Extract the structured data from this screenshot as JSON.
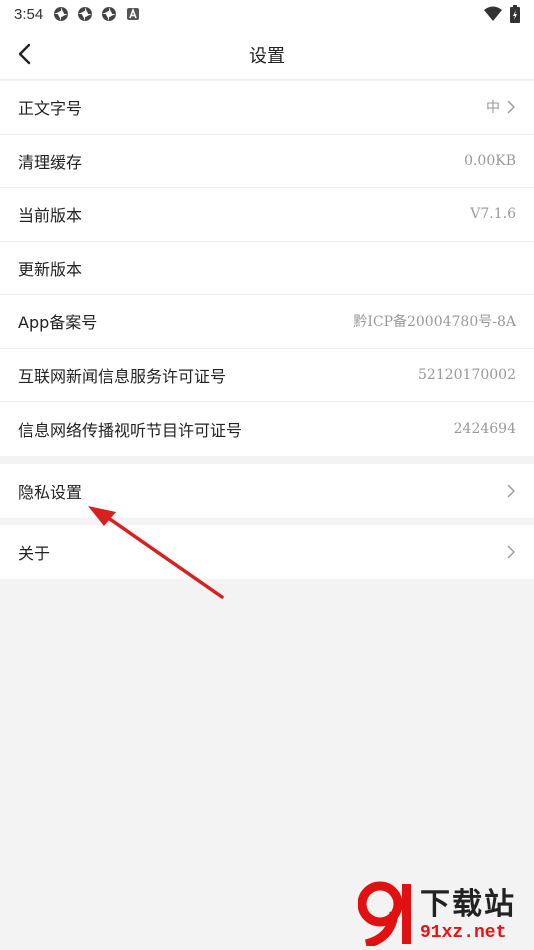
{
  "status_bar": {
    "time": "3:54",
    "icons": [
      "pinwheel-icon",
      "pinwheel-icon",
      "pinwheel-icon",
      "notification-a-icon"
    ],
    "right_icons": [
      "wifi-icon",
      "battery-charging-icon"
    ]
  },
  "header": {
    "title": "设置",
    "back_icon": "back-arrow-icon"
  },
  "settings": [
    {
      "label": "正文字号",
      "value": "中",
      "chevron": true
    },
    {
      "label": "清理缓存",
      "value": "0.00KB",
      "chevron": false
    },
    {
      "label": "当前版本",
      "value": "V7.1.6",
      "chevron": false
    },
    {
      "label": "更新版本",
      "value": "",
      "chevron": false
    },
    {
      "label": "App备案号",
      "value": "黔ICP备20004780号-8A",
      "chevron": false
    },
    {
      "label": "互联网新闻信息服务许可证号",
      "value": "52120170002",
      "chevron": false
    },
    {
      "label": "信息网络传播视听节目许可证号",
      "value": "2424694",
      "chevron": false
    }
  ],
  "privacy": {
    "label": "隐私设置"
  },
  "about": {
    "label": "关于"
  },
  "watermark": {
    "title": "下载站",
    "url": "91xz.net"
  },
  "colors": {
    "annotation_arrow": "#d92020",
    "watermark_red": "#e11111"
  }
}
